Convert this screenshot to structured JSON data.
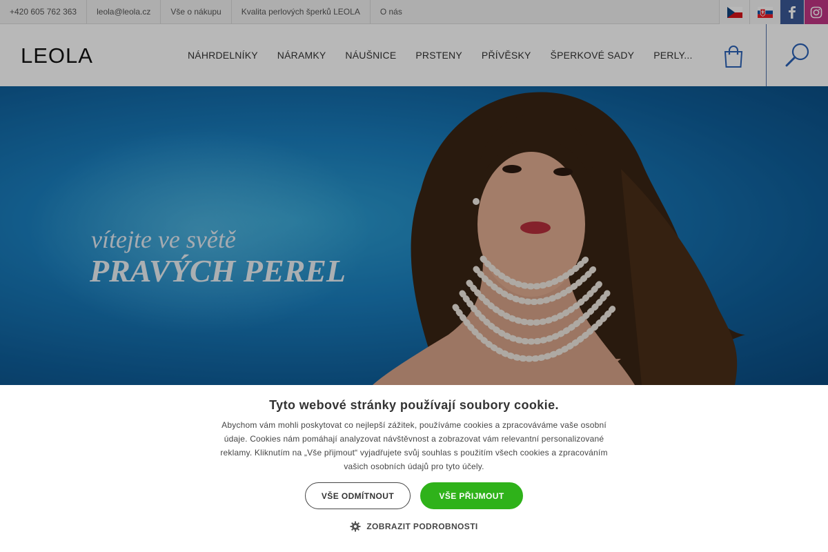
{
  "topbar": {
    "links": [
      "+420 605 762 363",
      "leola@leola.cz",
      "Vše o nákupu",
      "Kvalita perlových šperků LEOLA",
      "O nás"
    ],
    "flags": [
      "cz-flag-icon",
      "sk-flag-icon"
    ],
    "social": [
      "facebook-icon",
      "instagram-icon"
    ],
    "colors": {
      "facebook": "#3b5998",
      "instagram": "#c13584"
    }
  },
  "header": {
    "logo": "LEOLA",
    "nav": [
      "NÁHRDELNÍKY",
      "NÁRAMKY",
      "NÁUŠNICE",
      "PRSTENY",
      "PŘÍVĚSKY",
      "ŠPERKOVÉ SADY",
      "PERLY..."
    ],
    "icons": [
      "shopping-bag-icon",
      "search-icon"
    ]
  },
  "hero": {
    "line1": "vítejte ve světě",
    "line2": "PRAVÝCH PEREL"
  },
  "cookie": {
    "title": "Tyto webové stránky používají soubory cookie.",
    "text": "Abychom vám mohli poskytovat co nejlepší zážitek, používáme cookies a zpracováváme vaše osobní údaje. Cookies nám pomáhají analyzovat návštěvnost a zobrazovat vám relevantní personalizované reklamy. Kliknutím na „Vše přijmout“ vyjadřujete svůj souhlas s použitím všech cookies a zpracováním vašich osobních údajů pro tyto účely.",
    "decline": "VŠE ODMÍTNOUT",
    "accept": "VŠE PŘIJMOUT",
    "details": "ZOBRAZIT PODROBNOSTI",
    "accept_color": "#2fb21a"
  }
}
